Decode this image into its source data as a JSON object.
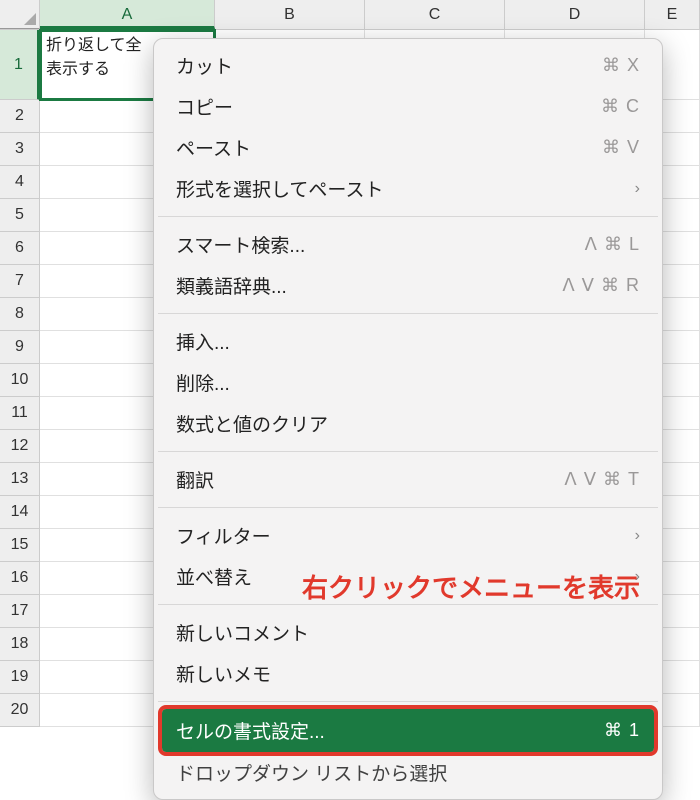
{
  "columns": {
    "A": "A",
    "B": "B",
    "C": "C",
    "D": "D",
    "E": "E"
  },
  "rows": [
    "1",
    "2",
    "3",
    "4",
    "5",
    "6",
    "7",
    "8",
    "9",
    "10",
    "11",
    "12",
    "13",
    "14",
    "15",
    "16",
    "17",
    "18",
    "19",
    "20"
  ],
  "cell_a1_line1": "折り返して全",
  "cell_a1_line2": "表示する",
  "menu": {
    "cut": {
      "label": "カット",
      "shortcut": "⌘ X"
    },
    "copy": {
      "label": "コピー",
      "shortcut": "⌘ C"
    },
    "paste": {
      "label": "ペースト",
      "shortcut": "⌘ V"
    },
    "paste_special": {
      "label": "形式を選択してペースト"
    },
    "smart_lookup": {
      "label": "スマート検索...",
      "shortcut": "ᐱ ⌘ L"
    },
    "thesaurus": {
      "label": "類義語辞典...",
      "shortcut": "ᐱ ᐯ ⌘ R"
    },
    "insert": {
      "label": "挿入..."
    },
    "delete": {
      "label": "削除..."
    },
    "clear": {
      "label": "数式と値のクリア"
    },
    "translate": {
      "label": "翻訳",
      "shortcut": "ᐱ ᐯ ⌘ T"
    },
    "filter": {
      "label": "フィルター"
    },
    "sort": {
      "label": "並べ替え"
    },
    "new_comment": {
      "label": "新しいコメント"
    },
    "new_note": {
      "label": "新しいメモ"
    },
    "format_cells": {
      "label": "セルの書式設定...",
      "shortcut": "⌘ 1"
    },
    "dropdown": {
      "label": "ドロップダウン リストから選択"
    }
  },
  "annotation": "右クリックでメニューを表示",
  "chevron": "›"
}
